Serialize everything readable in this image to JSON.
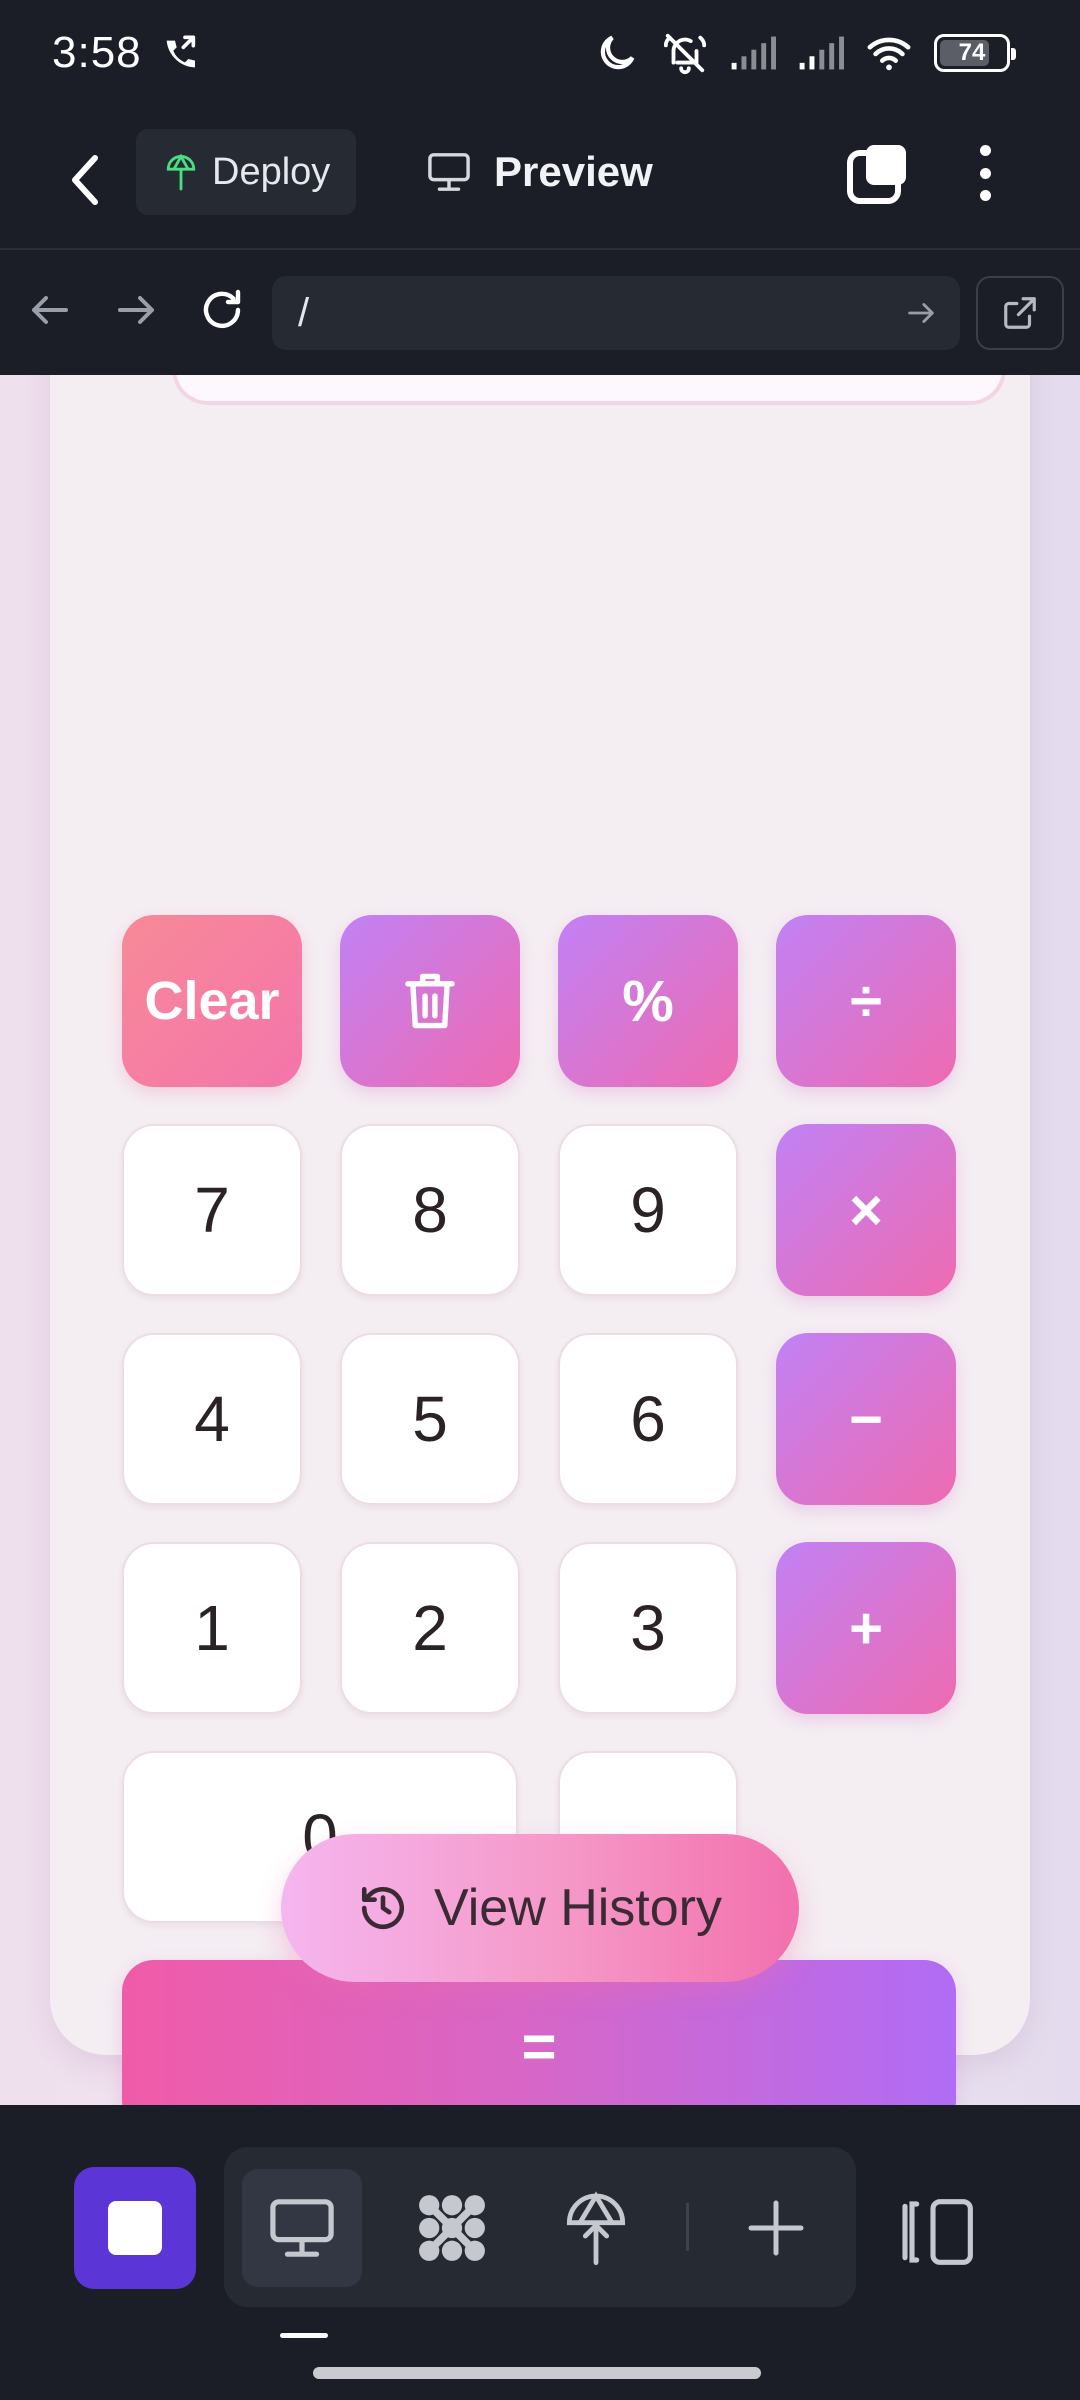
{
  "status_bar": {
    "time": "3:58",
    "battery": "74",
    "icons": [
      "phone-forwarded-icon",
      "moon-icon",
      "bell-off-icon",
      "signal-icon",
      "signal-icon",
      "wifi-icon",
      "battery-icon"
    ]
  },
  "toolbar": {
    "deploy_label": "Deploy",
    "preview_label": "Preview"
  },
  "browser": {
    "url": "/"
  },
  "calculator": {
    "display_value": "",
    "keys": {
      "clear": "Clear",
      "percent": "%",
      "divide": "÷",
      "multiply": "×",
      "minus": "−",
      "plus": "+",
      "seven": "7",
      "eight": "8",
      "nine": "9",
      "four": "4",
      "five": "5",
      "six": "6",
      "one": "1",
      "two": "2",
      "three": "3",
      "zero": "0",
      "dot": ".",
      "equals": "="
    },
    "history_label": "View History"
  },
  "colors": {
    "accent_gradient_start": "#c181f5",
    "accent_gradient_end": "#ee6bb0",
    "stop_button": "#5b35d6",
    "chrome_bg": "#1b1e27"
  }
}
